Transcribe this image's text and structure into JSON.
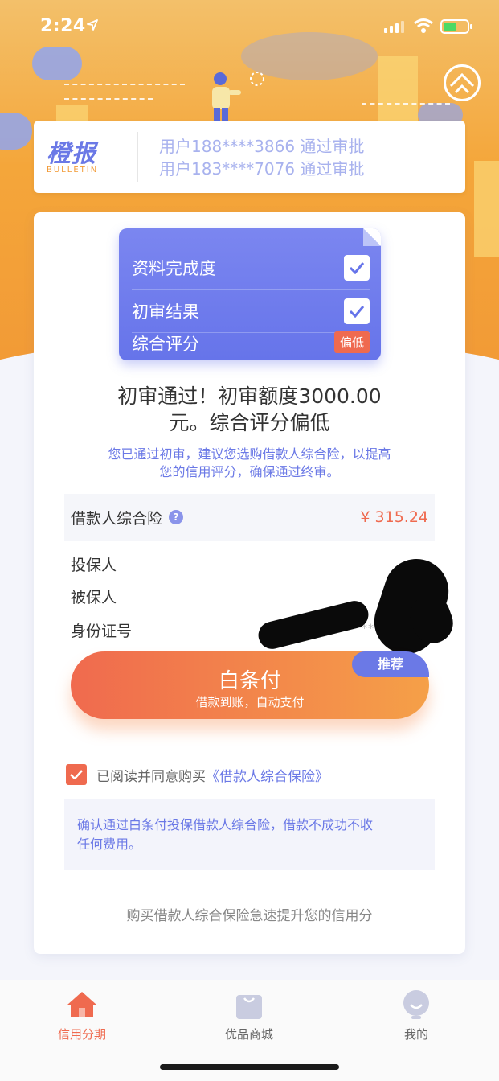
{
  "status_bar": {
    "time": "2:24"
  },
  "bulletin": {
    "logo_text": "橙报",
    "logo_sub": "BULLETIN",
    "lines": [
      "用户188****3866 通过审批",
      "用户183****7076 通过审批"
    ]
  },
  "checklist": {
    "items": [
      {
        "label": "资料完成度",
        "state": "checked"
      },
      {
        "label": "初审结果",
        "state": "checked"
      },
      {
        "label": "综合评分",
        "badge": "偏低"
      }
    ]
  },
  "result": {
    "title_line1": "初审通过！初审额度3000.00",
    "title_line2": "元。综合评分偏低",
    "subtitle_line1": "您已通过初审，建议您选购借款人综合险，以提高",
    "subtitle_line2": "您的信用评分，确保通过终审。"
  },
  "insurance": {
    "name": "借款人综合险",
    "help_icon": "?",
    "price": "¥ 315.24",
    "fields": [
      "投保人",
      "被保人",
      "身份证号"
    ],
    "id_masked": "****"
  },
  "pay_button": {
    "title": "白条付",
    "subtitle": "借款到账，自动支付",
    "badge": "推荐"
  },
  "agreement": {
    "checked": true,
    "text": "已阅读并同意购买",
    "link": "《借款人综合保险》"
  },
  "notice": {
    "line1": "确认通过白条付投保借款人综合险，借款不成功不收",
    "line2": "任何费用。"
  },
  "footer_text": "购买借款人综合保险急速提升您的信用分",
  "tabs": [
    {
      "label": "信用分期",
      "icon": "home-icon",
      "active": true
    },
    {
      "label": "优品商城",
      "icon": "shopping-bag-icon",
      "active": false
    },
    {
      "label": "我的",
      "icon": "profile-icon",
      "active": false
    }
  ],
  "colors": {
    "accent": "#6b79e6",
    "orange": "#ef6a4f",
    "hero": "#f4a63a"
  }
}
